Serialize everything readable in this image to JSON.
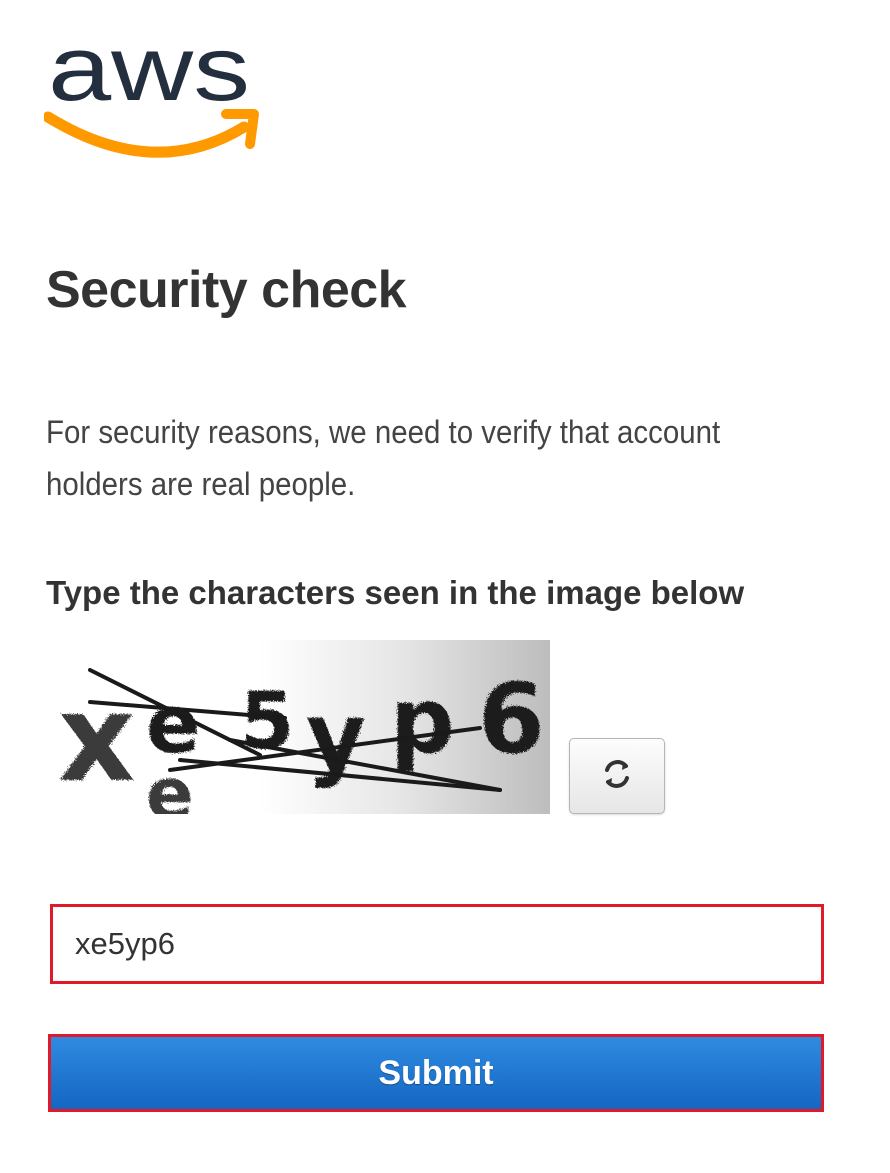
{
  "logo": {
    "text": "aws",
    "icon": "aws-smile-logo",
    "text_color": "#232f3e",
    "smile_color": "#ff9900"
  },
  "page": {
    "title": "Security check",
    "intro": "For security reasons, we need to verify that account holders are real people."
  },
  "captcha": {
    "label": "Type the characters seen in the image below",
    "image_text": "xe5yp6",
    "refresh_icon": "refresh-icon"
  },
  "form": {
    "answer_value": "xe5yp6",
    "submit_label": "Submit",
    "highlight_color": "#e01a2b",
    "button_color": "#1f73d1"
  }
}
